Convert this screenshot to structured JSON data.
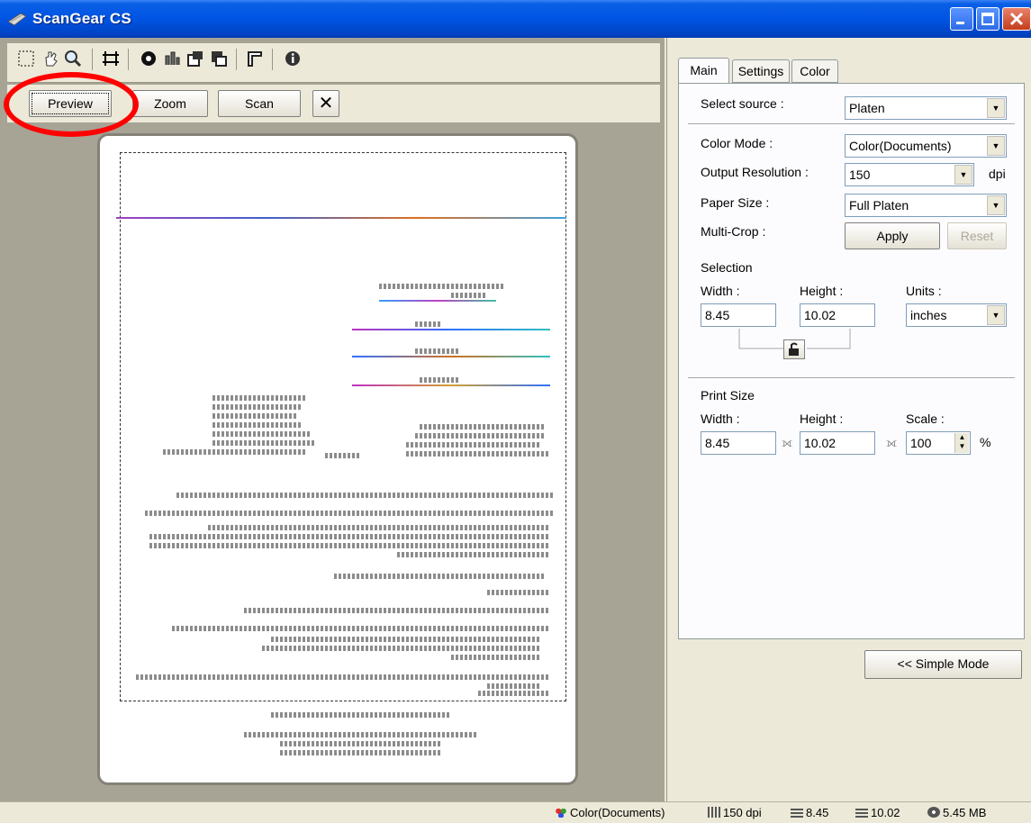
{
  "window": {
    "title": "ScanGear CS"
  },
  "toolbar": {
    "icons": [
      "crop-icon",
      "hand-icon",
      "magnifier-icon",
      "auto-crop-icon",
      "image-adjust-icon",
      "flip-icon",
      "rotate-left-icon",
      "rotate-right-icon",
      "ruler-icon",
      "info-icon"
    ]
  },
  "actions": {
    "preview": "Preview",
    "zoom": "Zoom",
    "scan": "Scan",
    "cancel": "✕"
  },
  "tabs": [
    "Main",
    "Settings",
    "Color"
  ],
  "main_tab": {
    "select_source_label": "Select source :",
    "select_source_value": "Platen",
    "color_mode_label": "Color Mode :",
    "color_mode_value": "Color(Documents)",
    "output_res_label": "Output Resolution :",
    "output_res_value": "150",
    "output_res_unit": "dpi",
    "paper_size_label": "Paper Size :",
    "paper_size_value": "Full Platen",
    "multi_crop_label": "Multi-Crop :",
    "apply_label": "Apply",
    "reset_label": "Reset",
    "selection_title": "Selection",
    "width_label": "Width :",
    "height_label": "Height :",
    "units_label": "Units :",
    "width_value": "8.45",
    "height_value": "10.02",
    "units_value": "inches",
    "print_size_title": "Print Size",
    "print_width_label": "Width :",
    "print_height_label": "Height :",
    "scale_label": "Scale :",
    "print_width_value": "8.45",
    "print_height_value": "10.02",
    "scale_value": "100",
    "scale_unit": "%"
  },
  "simple_mode_label": "<< Simple Mode",
  "status": {
    "color_mode": "Color(Documents)",
    "resolution": "150 dpi",
    "width": "8.45",
    "height": "10.02",
    "size": "5.45 MB"
  },
  "accent": {
    "titlebar": "#0054e3",
    "highlight_ring": "#ff0000"
  }
}
